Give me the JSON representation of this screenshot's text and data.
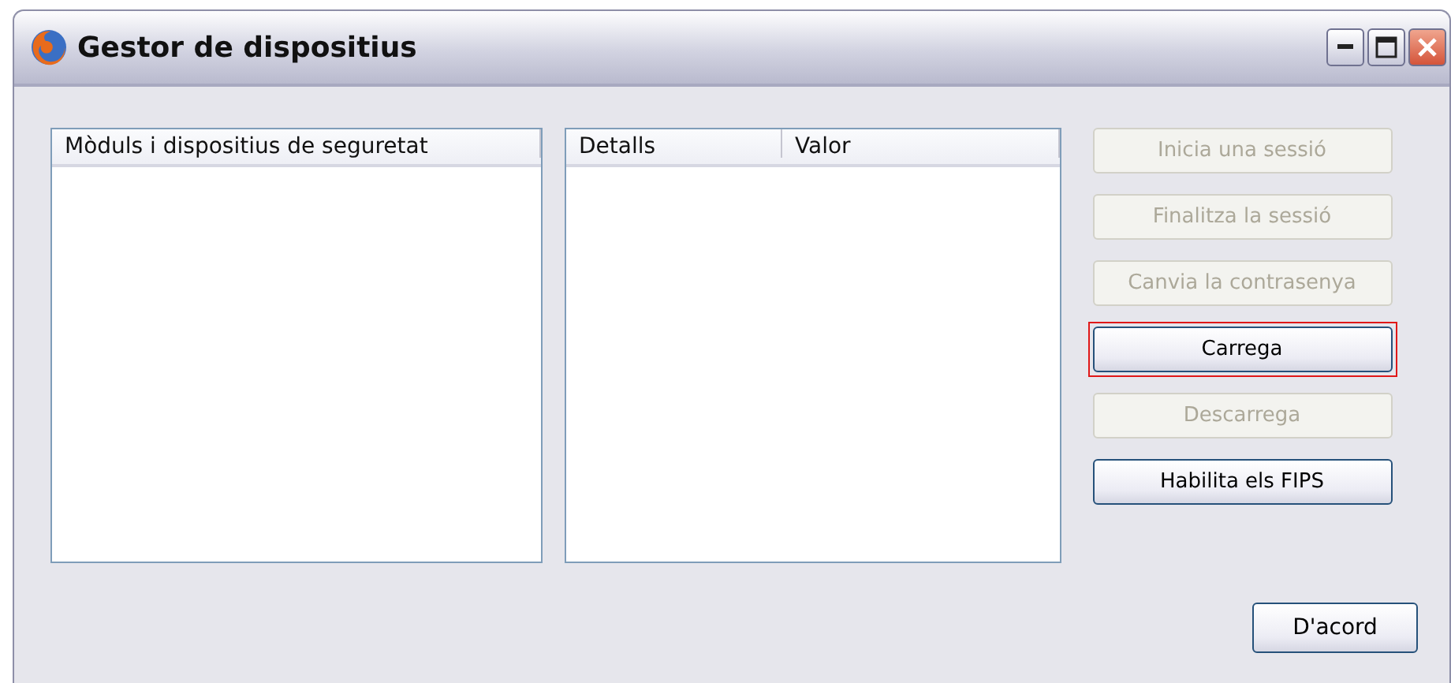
{
  "window": {
    "title": "Gestor de dispositius"
  },
  "title_buttons": [
    {
      "kind": "minimize"
    },
    {
      "kind": "maximize"
    },
    {
      "kind": "close"
    }
  ],
  "modules_list": {
    "columns": [
      "Mòduls i dispositius de seguretat"
    ]
  },
  "details_list": {
    "columns": [
      "Detalls",
      "Valor"
    ]
  },
  "side_buttons": [
    {
      "label": "Inicia una sessió",
      "disabled": true,
      "highlighted": false
    },
    {
      "label": "Finalitza la sessió",
      "disabled": true,
      "highlighted": false
    },
    {
      "label": "Canvia la contrasenya",
      "disabled": true,
      "highlighted": false
    },
    {
      "label": "Carrega",
      "disabled": false,
      "highlighted": true
    },
    {
      "label": "Descarrega",
      "disabled": true,
      "highlighted": false
    },
    {
      "label": "Habilita els FIPS",
      "disabled": false,
      "highlighted": false
    }
  ],
  "ok_button": {
    "label": "D'acord"
  }
}
